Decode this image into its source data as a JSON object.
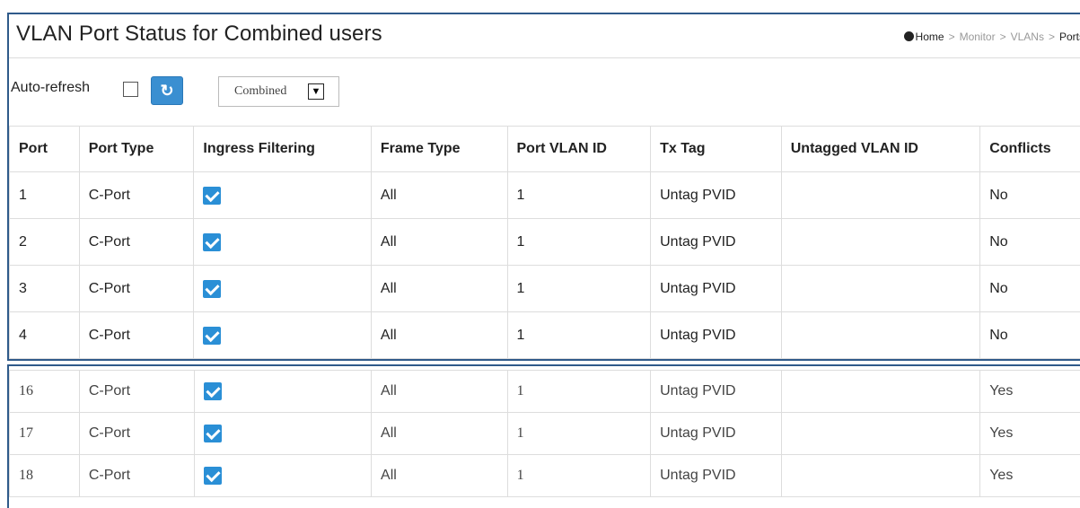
{
  "header": {
    "title": "VLAN Port Status for Combined users",
    "breadcrumb": [
      "Home",
      "Monitor",
      "VLANs",
      "Ports"
    ]
  },
  "toolbar": {
    "auto_refresh_label": "Auto-refresh",
    "auto_refresh_checked": false,
    "refresh_icon": "refresh-icon",
    "user_select_value": "Combined"
  },
  "table": {
    "columns": [
      "Port",
      "Port Type",
      "Ingress Filtering",
      "Frame Type",
      "Port VLAN ID",
      "Tx Tag",
      "Untagged VLAN ID",
      "Conflicts"
    ],
    "rows": [
      {
        "port": "1",
        "port_type": "C-Port",
        "ingress_filtering": true,
        "frame_type": "All",
        "pvid": "1",
        "tx_tag": "Untag PVID",
        "untagged_vid": "",
        "conflicts": "No"
      },
      {
        "port": "2",
        "port_type": "C-Port",
        "ingress_filtering": true,
        "frame_type": "All",
        "pvid": "1",
        "tx_tag": "Untag PVID",
        "untagged_vid": "",
        "conflicts": "No"
      },
      {
        "port": "3",
        "port_type": "C-Port",
        "ingress_filtering": true,
        "frame_type": "All",
        "pvid": "1",
        "tx_tag": "Untag PVID",
        "untagged_vid": "",
        "conflicts": "No"
      },
      {
        "port": "4",
        "port_type": "C-Port",
        "ingress_filtering": true,
        "frame_type": "All",
        "pvid": "1",
        "tx_tag": "Untag PVID",
        "untagged_vid": "",
        "conflicts": "No"
      }
    ],
    "bottom_rows": [
      {
        "port": "16",
        "port_type": "C-Port",
        "ingress_filtering": true,
        "frame_type": "All",
        "pvid": "1",
        "tx_tag": "Untag PVID",
        "untagged_vid": "",
        "conflicts": "Yes"
      },
      {
        "port": "17",
        "port_type": "C-Port",
        "ingress_filtering": true,
        "frame_type": "All",
        "pvid": "1",
        "tx_tag": "Untag PVID",
        "untagged_vid": "",
        "conflicts": "Yes"
      },
      {
        "port": "18",
        "port_type": "C-Port",
        "ingress_filtering": true,
        "frame_type": "All",
        "pvid": "1",
        "tx_tag": "Untag PVID",
        "untagged_vid": "",
        "conflicts": "Yes"
      }
    ]
  },
  "colors": {
    "accent": "#3a8fd1",
    "checkbox": "#2a8fd6",
    "panel_border": "#2f5a8a"
  }
}
